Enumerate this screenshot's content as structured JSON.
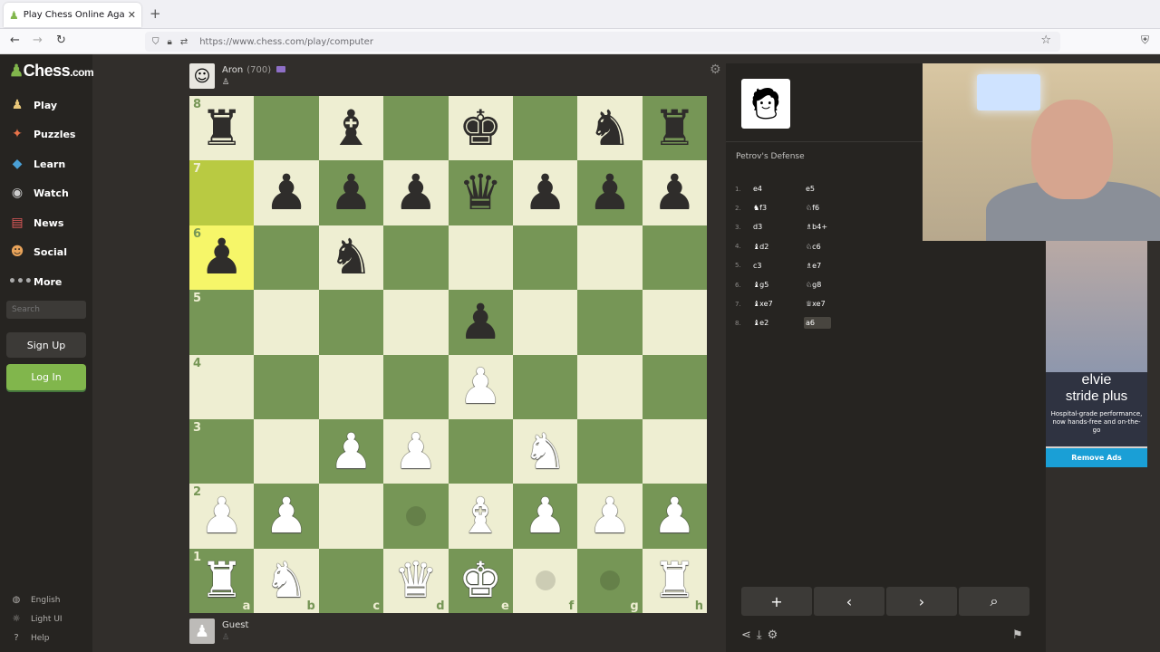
{
  "browser": {
    "tab_title": "Play Chess Online Against the C",
    "url": "https://www.chess.com/play/computer"
  },
  "sidebar": {
    "brand": "Chess",
    "brand_suffix": ".com",
    "nav": [
      {
        "label": "Play",
        "icon": "play-icon"
      },
      {
        "label": "Puzzles",
        "icon": "puzzles-icon"
      },
      {
        "label": "Learn",
        "icon": "learn-icon"
      },
      {
        "label": "Watch",
        "icon": "watch-icon"
      },
      {
        "label": "News",
        "icon": "news-icon"
      },
      {
        "label": "Social",
        "icon": "social-icon"
      },
      {
        "label": "More",
        "icon": "more-icon"
      }
    ],
    "search_placeholder": "Search",
    "signup": "Sign Up",
    "login": "Log In",
    "footer": [
      {
        "label": "English",
        "icon": "globe-icon"
      },
      {
        "label": "Light UI",
        "icon": "sun-icon"
      },
      {
        "label": "Help",
        "icon": "help-icon"
      }
    ]
  },
  "top_player": {
    "name": "Aron",
    "rating": "(700)"
  },
  "bottom_player": {
    "name": "Guest"
  },
  "board": {
    "ranks": [
      "8",
      "7",
      "6",
      "5",
      "4",
      "3",
      "2",
      "1"
    ],
    "files": [
      "a",
      "b",
      "c",
      "d",
      "e",
      "f",
      "g",
      "h"
    ],
    "light_color": "#eeeed2",
    "dark_color": "#769656",
    "highlight_squares": [
      "a7",
      "a6"
    ],
    "hint_squares": [
      "d2",
      "f1",
      "g1"
    ],
    "pieces": {
      "a8": "bR",
      "c8": "bB",
      "e8": "bK",
      "g8": "bN",
      "h8": "bR",
      "b7": "bP",
      "c7": "bP",
      "d7": "bP",
      "e7": "bQ",
      "f7": "bP",
      "g7": "bP",
      "h7": "bP",
      "a6": "bP",
      "c6": "bN",
      "e5": "bP",
      "e4": "wP",
      "c3": "wP",
      "d3": "wP",
      "f3": "wN",
      "a2": "wP",
      "b2": "wP",
      "e2": "wB",
      "f2": "wP",
      "g2": "wP",
      "h2": "wP",
      "a1": "wR",
      "b1": "wN",
      "d1": "wQ",
      "e1": "wK",
      "h1": "wR"
    }
  },
  "panel": {
    "opening": "Petrov's Defense",
    "moves": [
      {
        "n": "1.",
        "w": "e4",
        "b": "e5"
      },
      {
        "n": "2.",
        "w": "♞f3",
        "b": "♘f6"
      },
      {
        "n": "3.",
        "w": "d3",
        "b": "♗b4+"
      },
      {
        "n": "4.",
        "w": "♝d2",
        "b": "♘c6"
      },
      {
        "n": "5.",
        "w": "c3",
        "b": "♗e7"
      },
      {
        "n": "6.",
        "w": "♝g5",
        "b": "♘g8"
      },
      {
        "n": "7.",
        "w": "♝xe7",
        "b": "♕xe7"
      },
      {
        "n": "8.",
        "w": "♝e2",
        "b": "a6"
      }
    ],
    "selected_move": 7
  },
  "ad": {
    "brand": "elvie",
    "product": "stride plus",
    "tagline": "Hospital-grade performance, now hands-free and on-the-go",
    "remove": "Remove Ads"
  }
}
